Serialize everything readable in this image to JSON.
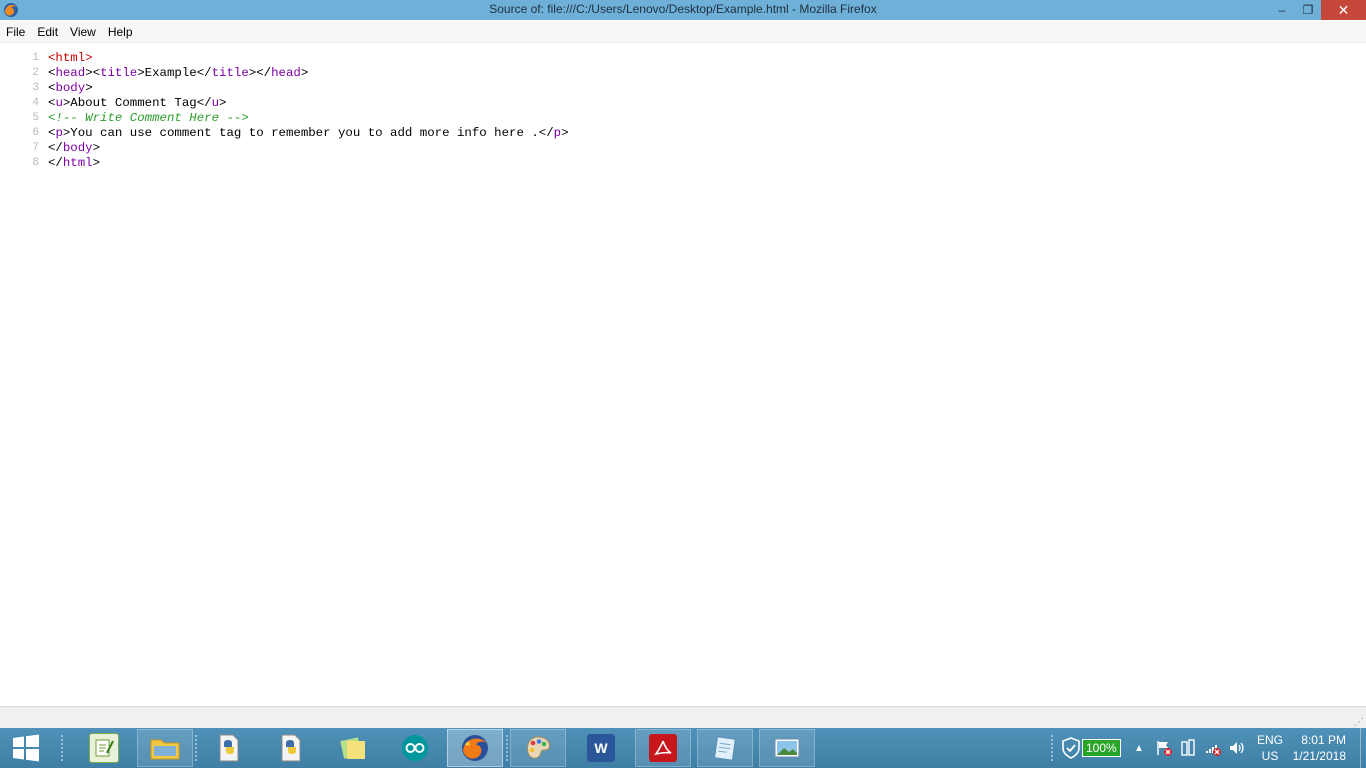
{
  "window": {
    "title": "Source of: file:///C:/Users/Lenovo/Desktop/Example.html - Mozilla Firefox",
    "minimize_label": "–",
    "restore_label": "❐",
    "close_label": "✕"
  },
  "menu": {
    "items": [
      {
        "label": "File"
      },
      {
        "label": "Edit"
      },
      {
        "label": "View"
      },
      {
        "label": "Help"
      }
    ]
  },
  "source": {
    "lines": [
      {
        "number": "1",
        "segments": [
          {
            "text": "<html>",
            "kind": "tag-red"
          }
        ]
      },
      {
        "number": "2",
        "segments": [
          {
            "text": "<",
            "kind": "plain"
          },
          {
            "text": "head",
            "kind": "tag"
          },
          {
            "text": "><",
            "kind": "plain"
          },
          {
            "text": "title",
            "kind": "tag"
          },
          {
            "text": ">Example</",
            "kind": "plain"
          },
          {
            "text": "title",
            "kind": "tag"
          },
          {
            "text": "></",
            "kind": "plain"
          },
          {
            "text": "head",
            "kind": "tag"
          },
          {
            "text": ">",
            "kind": "plain"
          }
        ]
      },
      {
        "number": "3",
        "segments": [
          {
            "text": "<",
            "kind": "plain"
          },
          {
            "text": "body",
            "kind": "tag"
          },
          {
            "text": ">",
            "kind": "plain"
          }
        ]
      },
      {
        "number": "4",
        "segments": [
          {
            "text": "<",
            "kind": "plain"
          },
          {
            "text": "u",
            "kind": "tag"
          },
          {
            "text": ">About Comment Tag</",
            "kind": "plain"
          },
          {
            "text": "u",
            "kind": "tag"
          },
          {
            "text": ">",
            "kind": "plain"
          }
        ]
      },
      {
        "number": "5",
        "segments": [
          {
            "text": "<!-- Write Comment Here -->",
            "kind": "cm"
          }
        ]
      },
      {
        "number": "6",
        "segments": [
          {
            "text": "<",
            "kind": "plain"
          },
          {
            "text": "p",
            "kind": "tag"
          },
          {
            "text": ">You can use comment tag to remember you to add more info here .</",
            "kind": "plain"
          },
          {
            "text": "p",
            "kind": "tag"
          },
          {
            "text": ">",
            "kind": "plain"
          }
        ]
      },
      {
        "number": "7",
        "segments": [
          {
            "text": "</",
            "kind": "plain"
          },
          {
            "text": "body",
            "kind": "tag"
          },
          {
            "text": ">",
            "kind": "plain"
          }
        ]
      },
      {
        "number": "8",
        "segments": [
          {
            "text": "</",
            "kind": "plain"
          },
          {
            "text": "html",
            "kind": "tag"
          },
          {
            "text": ">",
            "kind": "plain"
          }
        ]
      }
    ]
  },
  "taskbar": {
    "apps": [
      {
        "name": "start-button",
        "icon": "windows-logo-icon"
      },
      {
        "name": "taskbar-notepadpp",
        "icon": "notepad-plus-plus-icon"
      },
      {
        "name": "taskbar-file-explorer",
        "icon": "folder-icon"
      },
      {
        "name": "taskbar-python-1",
        "icon": "python-file-icon"
      },
      {
        "name": "taskbar-python-2",
        "icon": "python-file-icon"
      },
      {
        "name": "taskbar-sticky-notes",
        "icon": "sticky-notes-icon"
      },
      {
        "name": "taskbar-arduino",
        "icon": "arduino-icon"
      },
      {
        "name": "taskbar-firefox",
        "icon": "firefox-icon"
      },
      {
        "name": "taskbar-paint",
        "icon": "paint-palette-icon"
      },
      {
        "name": "taskbar-word",
        "icon": "word-icon"
      },
      {
        "name": "taskbar-acrobat",
        "icon": "acrobat-icon"
      },
      {
        "name": "taskbar-notepad",
        "icon": "notepad-icon"
      },
      {
        "name": "taskbar-photos",
        "icon": "photo-viewer-icon"
      }
    ],
    "word_letter": "W",
    "battery": "100%",
    "language": "ENG",
    "region": "US",
    "time": "8:01 PM",
    "date": "1/21/2018"
  },
  "colors": {
    "title_bar": "#6fb0d9",
    "taskbar": "#4688b0",
    "close_button": "#c7463a",
    "line_number": "#b9b9b9",
    "tag_html": "#cc0000",
    "tag": "#7f00a6",
    "comment": "#2b9c2b"
  }
}
